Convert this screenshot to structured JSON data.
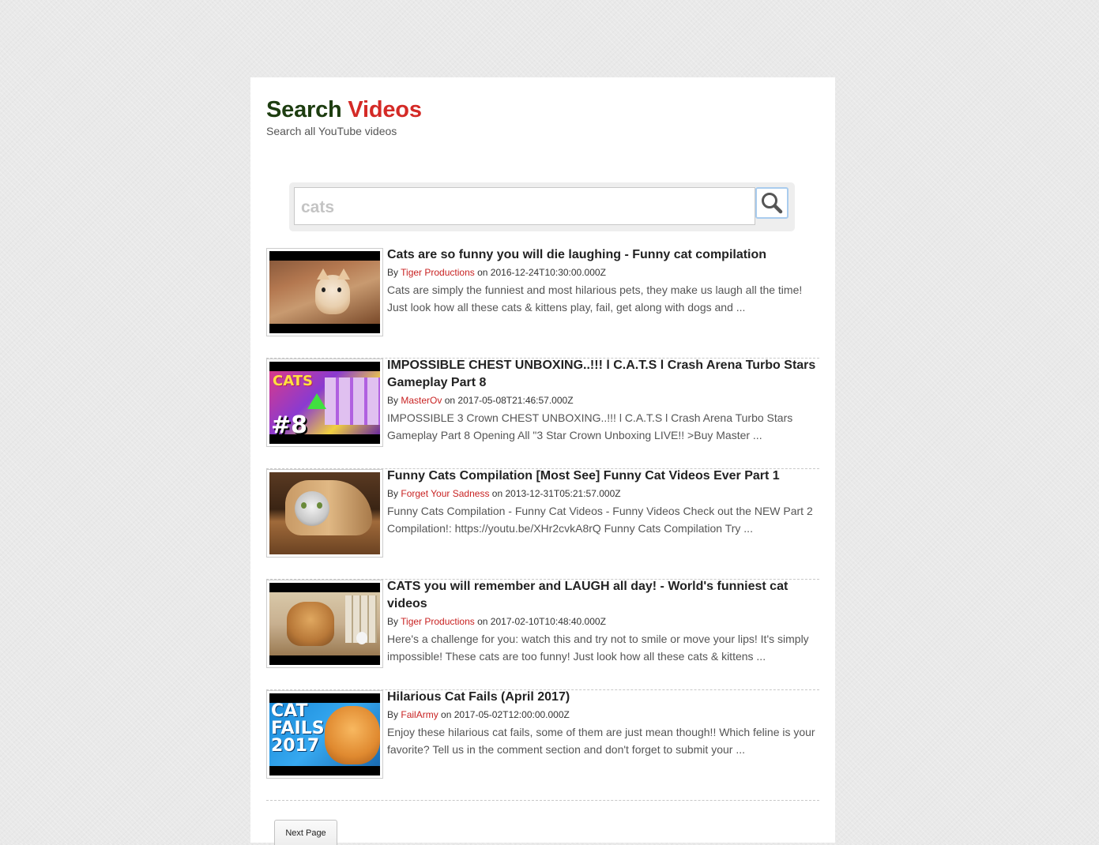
{
  "header": {
    "title_part1": "Search",
    "title_part2": "Videos",
    "subtitle": "Search all YouTube videos"
  },
  "search": {
    "value": "cats",
    "button_icon": "search-icon"
  },
  "results": [
    {
      "title": "Cats are so funny you will die laughing - Funny cat compilation",
      "by_label": "By",
      "channel": "Tiger Productions",
      "on_label": "on",
      "date": "2016-12-24T10:30:00.000Z",
      "description": "Cats are simply the funniest and most hilarious pets, they make us laugh all the time! Just look how all these cats & kittens play, fail, get along with dogs and ..."
    },
    {
      "title": "IMPOSSIBLE CHEST UNBOXING..!!! l C.A.T.S l Crash Arena Turbo Stars Gameplay Part 8",
      "by_label": "By",
      "channel": "MasterOv",
      "on_label": "on",
      "date": "2017-05-08T21:46:57.000Z",
      "description": "IMPOSSIBLE 3 Crown CHEST UNBOXING..!!! l C.A.T.S l Crash Arena Turbo Stars Gameplay Part 8 Opening All \"3 Star Crown Unboxing LIVE!! >Buy Master ...",
      "thumb_text_top": "CATS",
      "thumb_text_bottom": "#8"
    },
    {
      "title": "Funny Cats Compilation [Most See] Funny Cat Videos Ever Part 1",
      "by_label": "By",
      "channel": "Forget Your Sadness",
      "on_label": "on",
      "date": "2013-12-31T05:21:57.000Z",
      "description": "Funny Cats Compilation - Funny Cat Videos - Funny Videos Check out the NEW Part 2 Compilation!: https://youtu.be/XHr2cvkA8rQ Funny Cats Compilation Try ..."
    },
    {
      "title": "CATS you will remember and LAUGH all day! - World's funniest cat videos",
      "by_label": "By",
      "channel": "Tiger Productions",
      "on_label": "on",
      "date": "2017-02-10T10:48:40.000Z",
      "description": "Here's a challenge for you: watch this and try not to smile or move your lips! It's simply impossible! These cats are too funny! Just look how all these cats & kittens ..."
    },
    {
      "title": "Hilarious Cat Fails (April 2017)",
      "by_label": "By",
      "channel": "FailArmy",
      "on_label": "on",
      "date": "2017-05-02T12:00:00.000Z",
      "description": "Enjoy these hilarious cat fails, some of them are just mean though!! Which feline is your favorite? Tell us in the comment section and don't forget to submit your ...",
      "thumb_text_line1": "CAT",
      "thumb_text_line2": "FAILS",
      "thumb_text_line3": "2017"
    }
  ],
  "pagination": {
    "next_label": "Next Page"
  },
  "colors": {
    "title_dark": "#1d3d10",
    "title_accent": "#d42a26",
    "channel_link": "#c82222",
    "search_button_border": "#a9ccee"
  }
}
